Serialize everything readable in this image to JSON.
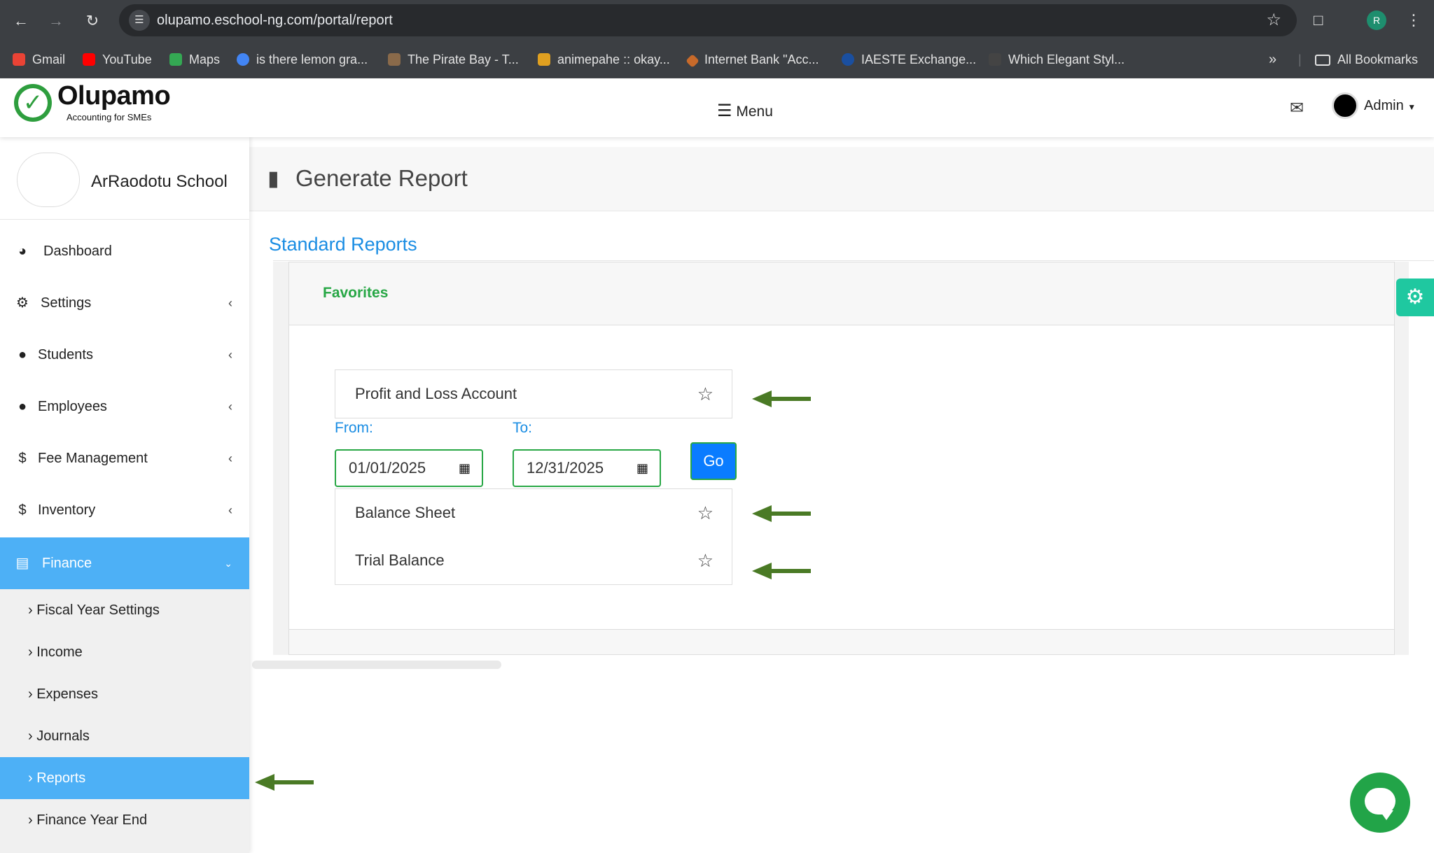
{
  "browser": {
    "url": "olupamo.eschool-ng.com/portal/report",
    "profile_initial": "R",
    "bookmarks": [
      {
        "label": "Gmail",
        "color": "#ea4335"
      },
      {
        "label": "YouTube",
        "color": "#ff0000"
      },
      {
        "label": "Maps",
        "color": "#34a853"
      },
      {
        "label": "is there lemon gra...",
        "color": "#4285f4"
      },
      {
        "label": "The Pirate Bay - T...",
        "color": "#8a6a4a"
      },
      {
        "label": "animepahe :: okay...",
        "color": "#e0a020"
      },
      {
        "label": "Internet Bank \"Acc...",
        "color": "#c86a2a"
      },
      {
        "label": "IAESTE Exchange...",
        "color": "#1a4fa0"
      },
      {
        "label": "Which Elegant Styl...",
        "color": "#444444"
      }
    ],
    "all_bookmarks": "All Bookmarks"
  },
  "header": {
    "logo_name": "Olupamo",
    "logo_tagline": "Accounting for SMEs",
    "menu_label": "Menu",
    "user_name": "Admin"
  },
  "sidebar": {
    "school_name": "ArRaodotu School",
    "items": [
      {
        "label": "Dashboard",
        "icon": "dashboard-icon"
      },
      {
        "label": "Settings",
        "icon": "gear-icon"
      },
      {
        "label": "Students",
        "icon": "user-icon"
      },
      {
        "label": "Employees",
        "icon": "user-icon"
      },
      {
        "label": "Fee Management",
        "icon": "dollar-icon"
      },
      {
        "label": "Inventory",
        "icon": "dollar-icon"
      },
      {
        "label": "Finance",
        "icon": "book-icon"
      }
    ],
    "finance_sub": [
      "Fiscal Year Settings",
      "Income",
      "Expenses",
      "Journals",
      "Reports",
      "Finance Year End"
    ],
    "active_color": "#4db0f6"
  },
  "main": {
    "page_title": "Generate Report",
    "section_title": "Standard Reports",
    "card_title": "Favorites",
    "reports": [
      "Profit and Loss Account",
      "Balance Sheet",
      "Trial Balance"
    ],
    "from_label": "From:",
    "to_label": "To:",
    "from_value": "01/01/2025",
    "to_value": "12/31/2025",
    "go_label": "Go"
  },
  "colors": {
    "accent_blue": "#1a8de3",
    "favorites_green": "#27a745",
    "annotation_arrow": "#4a7a25",
    "chat_green": "#22a448",
    "settings_tab": "#1fc8a0"
  }
}
